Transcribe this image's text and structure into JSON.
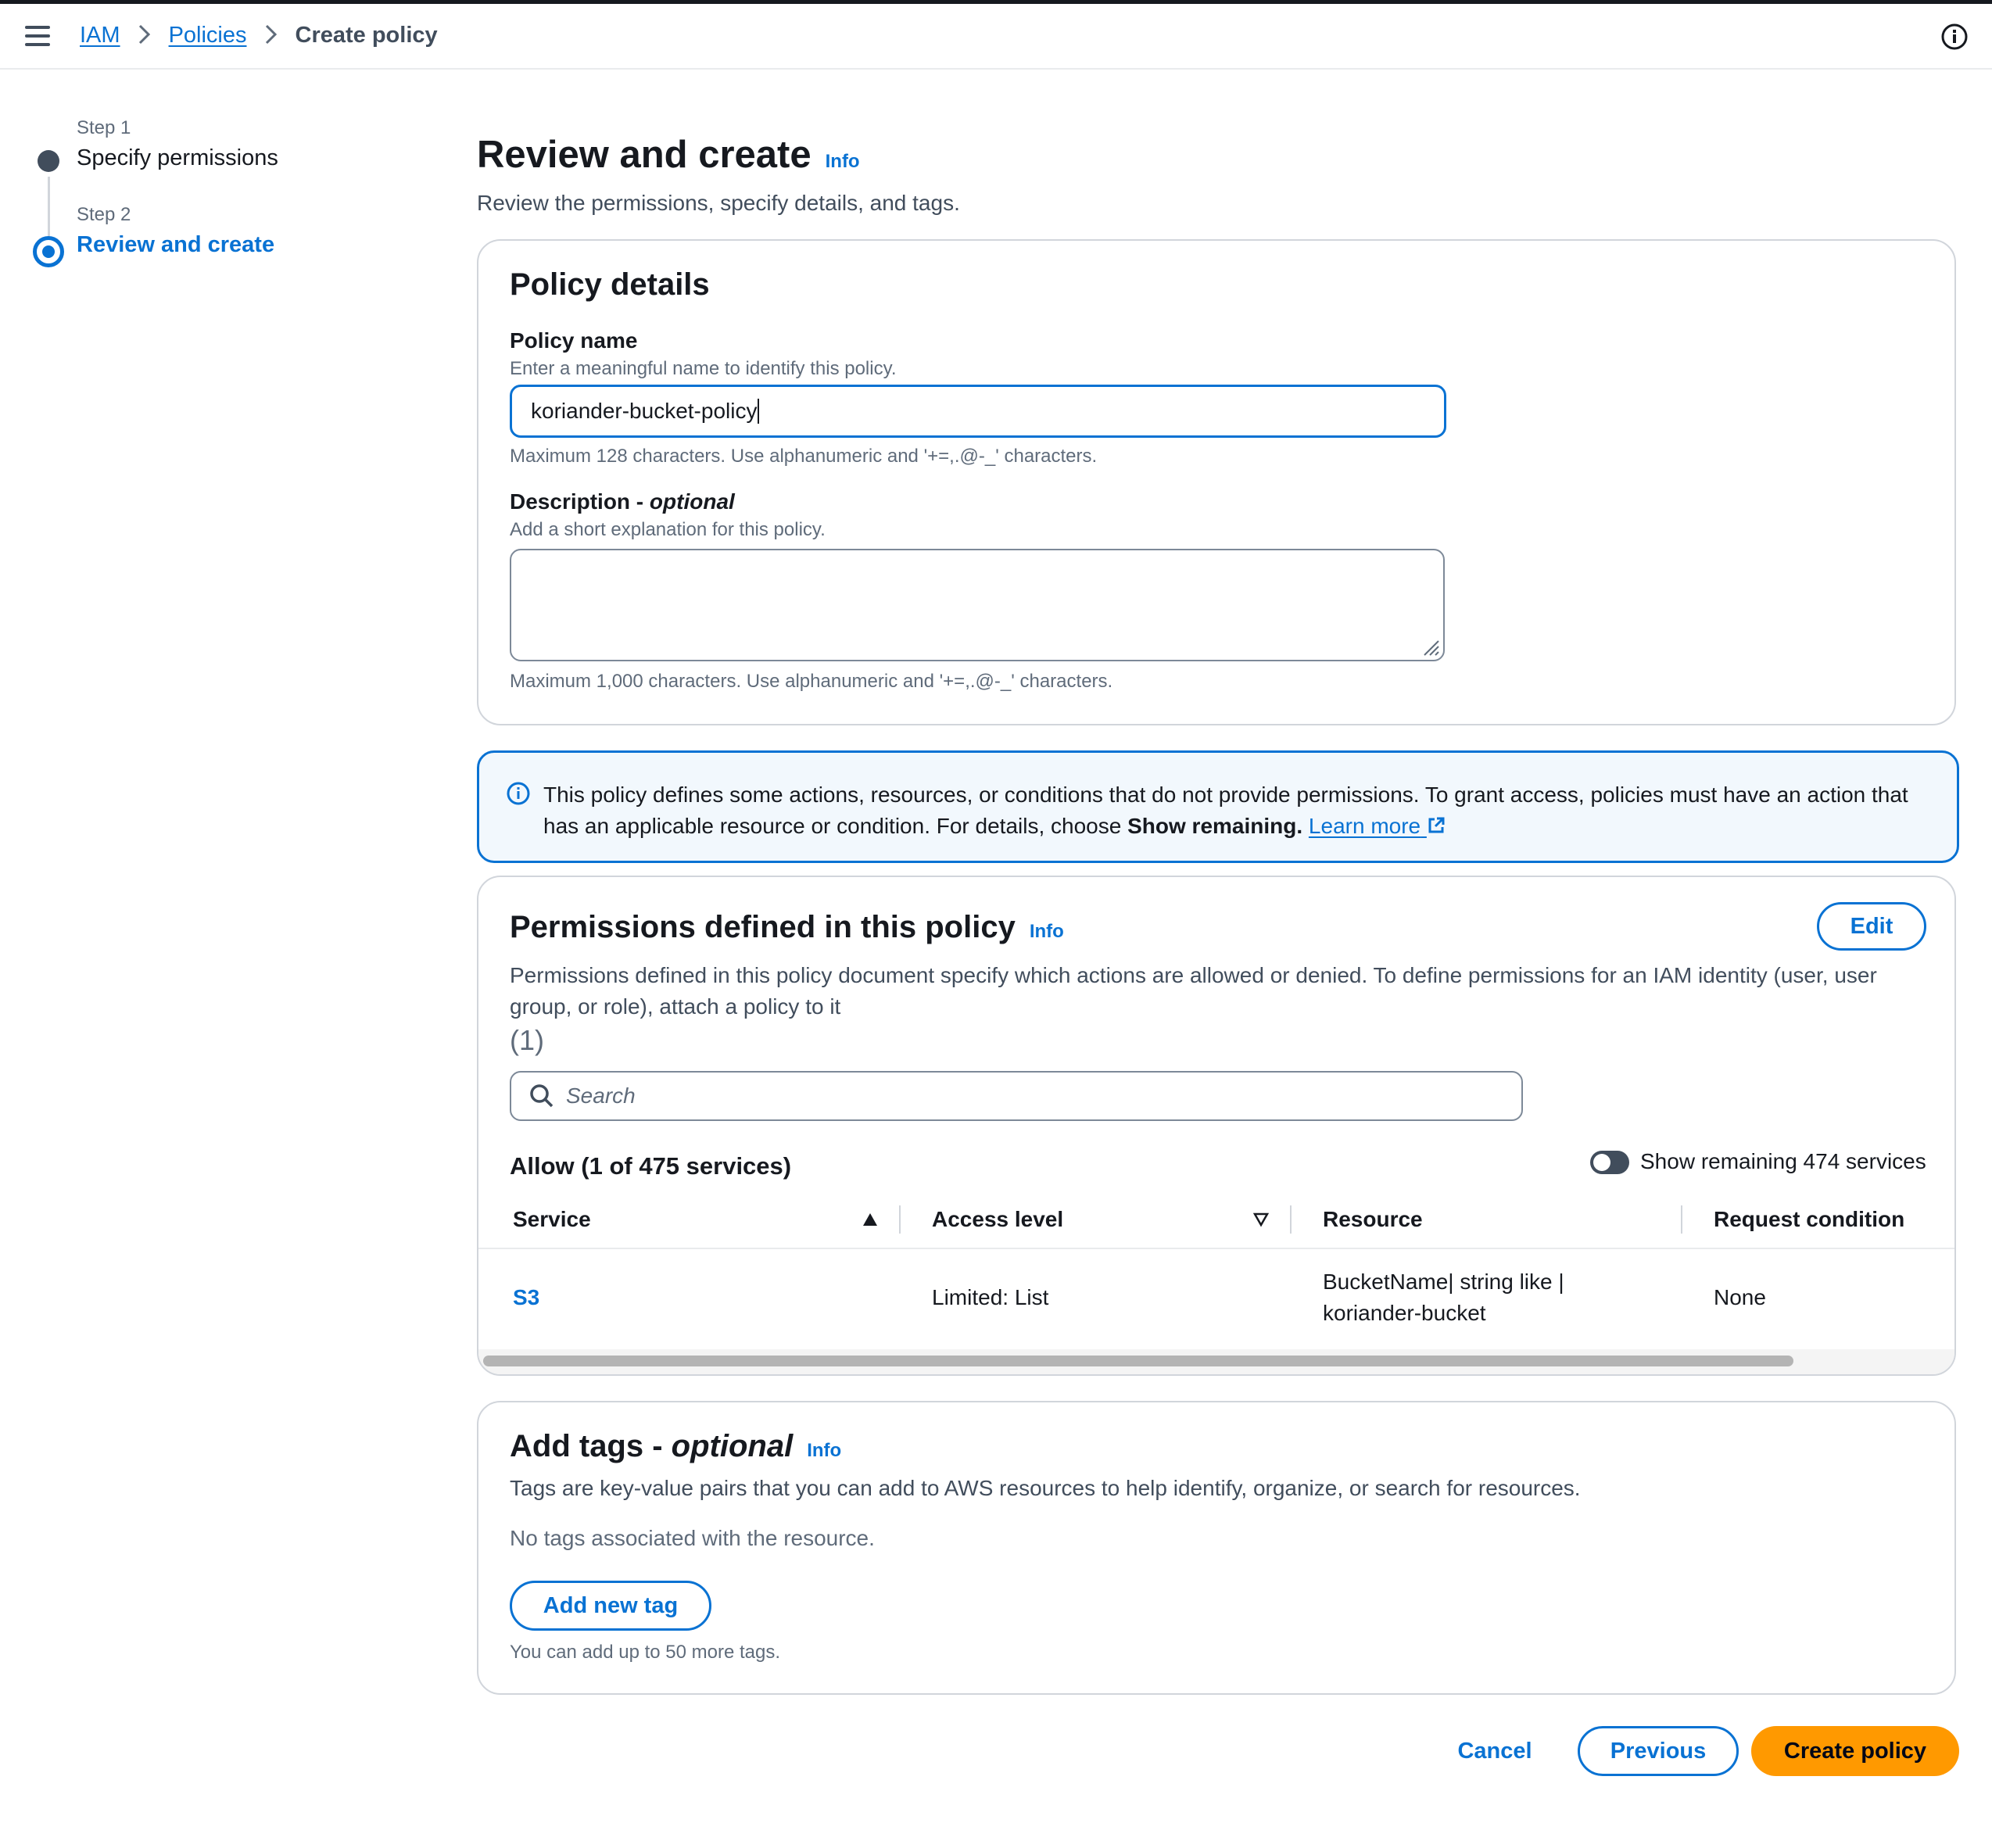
{
  "breadcrumb": {
    "items": [
      "IAM",
      "Policies"
    ],
    "current": "Create policy"
  },
  "steps": [
    {
      "label": "Step 1",
      "title": "Specify permissions",
      "state": "done"
    },
    {
      "label": "Step 2",
      "title": "Review and create",
      "state": "active"
    }
  ],
  "page": {
    "title": "Review and create",
    "info": "Info",
    "description": "Review the permissions, specify details, and tags."
  },
  "policy_details": {
    "title": "Policy details",
    "name_label": "Policy name",
    "name_desc": "Enter a meaningful name to identify this policy.",
    "name_value": "koriander-bucket-policy",
    "name_constraint": "Maximum 128 characters. Use alphanumeric and '+=,.@-_' characters.",
    "desc_label": "Description",
    "desc_label_suffix": " - ",
    "desc_optional": "optional",
    "desc_desc": "Add a short explanation for this policy.",
    "desc_value": "",
    "desc_constraint": "Maximum 1,000 characters. Use alphanumeric and '+=,.@-_' characters."
  },
  "alert": {
    "text_before": "This policy defines some actions, resources, or conditions that do not provide permissions. To grant access, policies must have an action that has an applicable resource or condition. For details, choose ",
    "bold": "Show remaining.",
    "link": "Learn more"
  },
  "permissions": {
    "title": "Permissions defined in this policy",
    "info": "Info",
    "edit": "Edit",
    "description": "Permissions defined in this policy document specify which actions are allowed or denied. To define permissions for an IAM identity (user, user group, or role), attach a policy to it",
    "count": "(1)",
    "search_placeholder": "Search",
    "allow_heading": "Allow (1 of 475 services)",
    "toggle_label": "Show remaining 474 services",
    "columns": [
      "Service",
      "Access level",
      "Resource",
      "Request condition"
    ],
    "rows": [
      {
        "service": "S3",
        "access_level": "Limited: List",
        "resource_line1": "BucketName| string like |",
        "resource_line2": "koriander-bucket",
        "request_condition": "None"
      }
    ]
  },
  "tags": {
    "title": "Add tags",
    "title_suffix": " - ",
    "optional": "optional",
    "info": "Info",
    "description": "Tags are key-value pairs that you can add to AWS resources to help identify, organize, or search for resources.",
    "empty": "No tags associated with the resource.",
    "add_button": "Add new tag",
    "limit": "You can add up to 50 more tags."
  },
  "footer": {
    "cancel": "Cancel",
    "previous": "Previous",
    "create": "Create policy"
  },
  "colors": {
    "link_blue": "#0972d3",
    "primary_orange": "#ff9900",
    "alert_bg": "#f2f8fd"
  },
  "icons": [
    "menu-icon",
    "chevron-right-icon",
    "info-circle-icon",
    "search-icon",
    "external-link-icon",
    "sort-ascending-icon",
    "sort-descending-icon"
  ]
}
